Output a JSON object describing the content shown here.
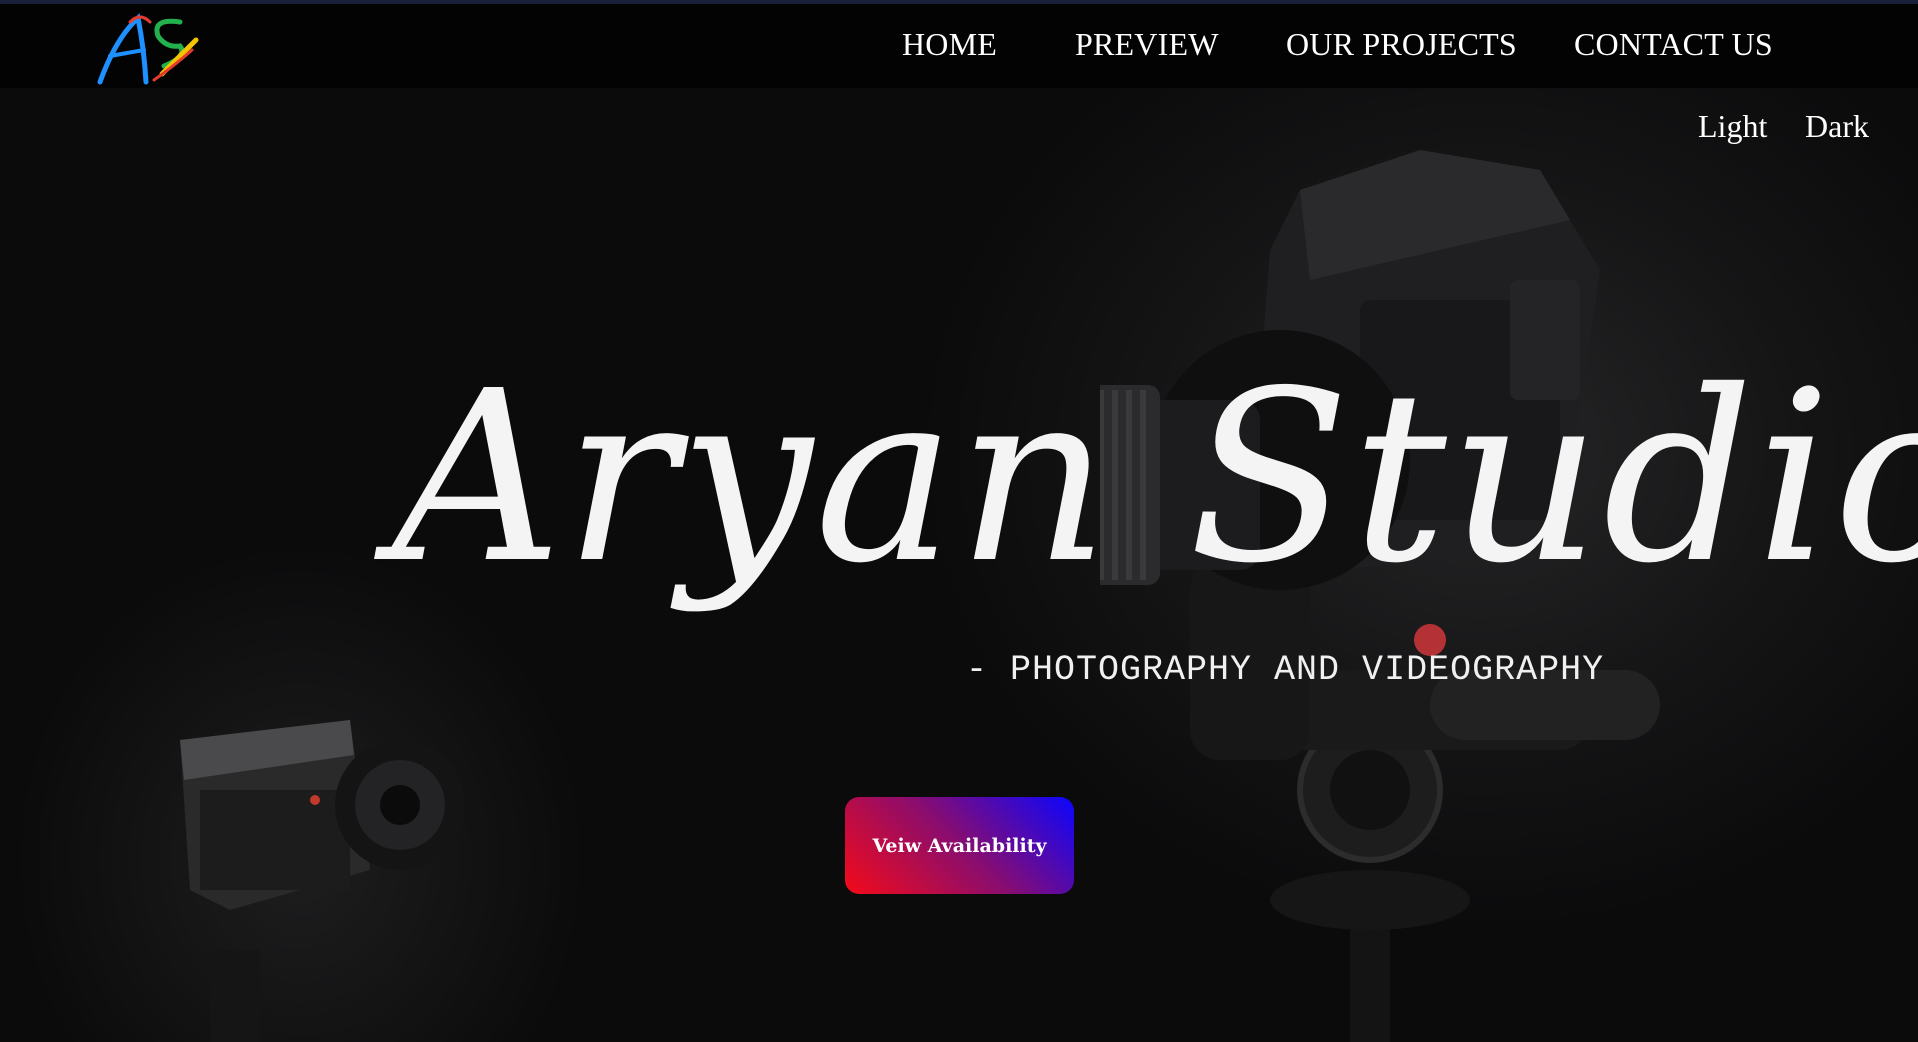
{
  "brand": {
    "logo_text": "AS",
    "logo_colors": [
      "#1e90ff",
      "#e33b2e",
      "#22b14c",
      "#f5c400"
    ]
  },
  "nav": {
    "items": [
      {
        "label": "HOME"
      },
      {
        "label": "PREVIEW"
      },
      {
        "label": "OUR PROJECTS"
      },
      {
        "label": "CONTACT US"
      }
    ]
  },
  "theme_toggle": {
    "light_label": "Light",
    "dark_label": "Dark"
  },
  "hero": {
    "title": "Aryan Studio",
    "subtitle": "- PHOTOGRAPHY AND VIDEOGRAPHY",
    "cta_label": "Veiw Availability"
  },
  "colors": {
    "background": "#0b0b0c",
    "navbar": "#030303",
    "text": "#ffffff",
    "cta_gradient": [
      "#f50a18",
      "#8a0d6e",
      "#0b05ff"
    ]
  }
}
